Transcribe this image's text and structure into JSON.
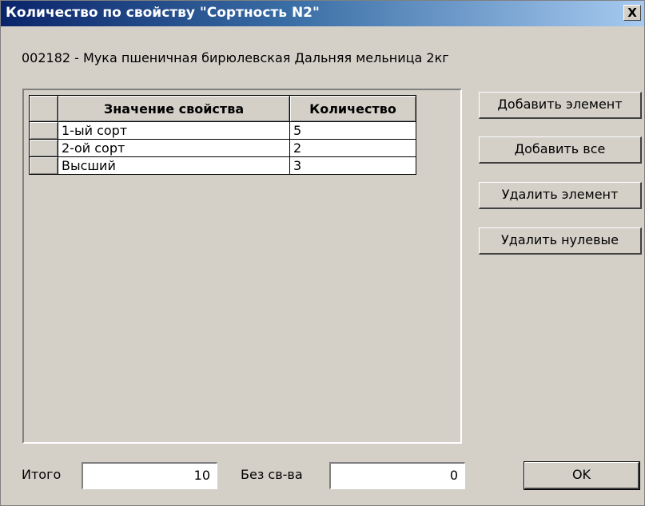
{
  "window": {
    "title": "Количество по свойству \"Сортность N2\"",
    "close_label": "X"
  },
  "item": {
    "label": "002182 - Мука пшеничная бирюлевская Дальняя мельница 2кг"
  },
  "table": {
    "headers": [
      "Значение свойства",
      "Количество"
    ],
    "rows": [
      {
        "value": "1-ый сорт",
        "qty": "5"
      },
      {
        "value": "2-ой сорт",
        "qty": "2"
      },
      {
        "value": "Высший",
        "qty": "3"
      }
    ]
  },
  "buttons": {
    "add_element": "Добавить элемент",
    "add_all": "Добавить все",
    "delete_element": "Удалить элемент",
    "delete_zero": "Удалить нулевые",
    "ok": "OK"
  },
  "footer": {
    "total_label": "Итого",
    "total_value": "10",
    "no_prop_label": "Без св-ва",
    "no_prop_value": "0"
  }
}
